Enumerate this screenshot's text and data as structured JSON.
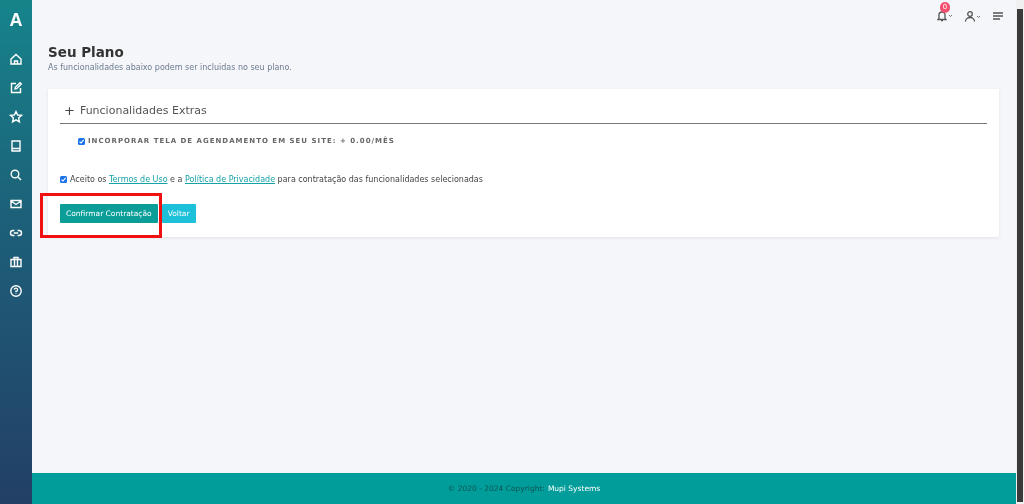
{
  "sidebar": {
    "logo": "A"
  },
  "topbar": {
    "notifications": "0"
  },
  "page": {
    "title": "Seu Plano",
    "subtitle": "As funcionalidades abaixo podem ser incluidas no seu plano."
  },
  "section": {
    "icon": "+",
    "title": "Funcionalidades Extras"
  },
  "features": [
    {
      "label": "INCORPORAR TELA DE AGENDAMENTO EM SEU SITE: + 0.00/MÊS",
      "checked": true
    }
  ],
  "terms": {
    "checked": true,
    "parts": [
      {
        "kind": "text",
        "text": "Aceito os"
      },
      {
        "kind": "link",
        "text": "Termos de Uso"
      },
      {
        "kind": "text",
        "text": "e a"
      },
      {
        "kind": "link",
        "text": "Política de Privacidade"
      },
      {
        "kind": "text",
        "text": "para contratação das funcionalidades selecionadas"
      }
    ]
  },
  "buttons": [
    {
      "label": "Confirmar Contratação",
      "kind": "primary",
      "highlighted": true
    },
    {
      "label": "Voltar",
      "kind": "secondary",
      "highlighted": false
    }
  ],
  "footer": {
    "text": "© 2020 - 2024 Copyright:",
    "link": "Mupi Systems"
  }
}
